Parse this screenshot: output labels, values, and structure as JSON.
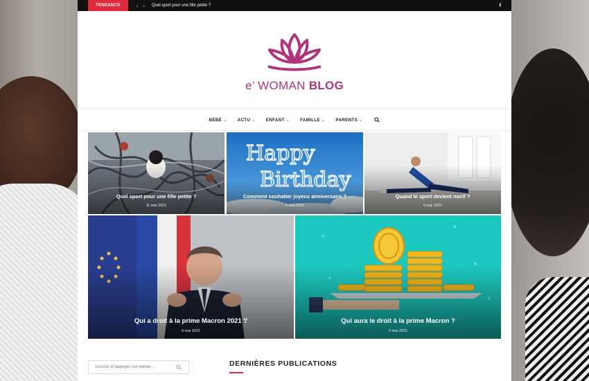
{
  "topbar": {
    "trend_label": "TENDANCE",
    "trend_headline": "Quel sport pour une fille petite ?",
    "social_icon": "facebook-icon"
  },
  "brand": {
    "name_prefix": "e’ WOMAN ",
    "name_strong": "BLOG",
    "color": "#b0347a",
    "logo_icon": "lotus-icon"
  },
  "nav": {
    "items": [
      {
        "label": "BÉBÉ"
      },
      {
        "label": "ACTU"
      },
      {
        "label": "ENFANT"
      },
      {
        "label": "FAMILLE"
      },
      {
        "label": "PARENTS"
      }
    ],
    "search_icon": "search-icon"
  },
  "featured": [
    {
      "title": "Quel sport pour une fille petite ?",
      "date": "11 mai 2021"
    },
    {
      "title": "Comment souhaiter joyeux anniversaire ?",
      "date": "6 mai 2021"
    },
    {
      "title": "Quand le sport devient nocif ?",
      "date": "6 mai 2021"
    },
    {
      "title": "Qui a droit à la prime Macron 2021 ?",
      "date": "4 mai 2021"
    },
    {
      "title": "Qui aura le droit à la prime Macron ?",
      "date": "2 mai 2021"
    }
  ],
  "birthday_image_text": {
    "line1": "Happy",
    "line2": "Birthday"
  },
  "sidebar": {
    "search_placeholder": "Ecrivez et appuyez sur entrée ..."
  },
  "latest": {
    "heading": "DERNIÈRES PUBLICATIONS"
  },
  "colors": {
    "accent": "#e12a3c",
    "brand": "#b0347a",
    "topbar": "#111111"
  }
}
